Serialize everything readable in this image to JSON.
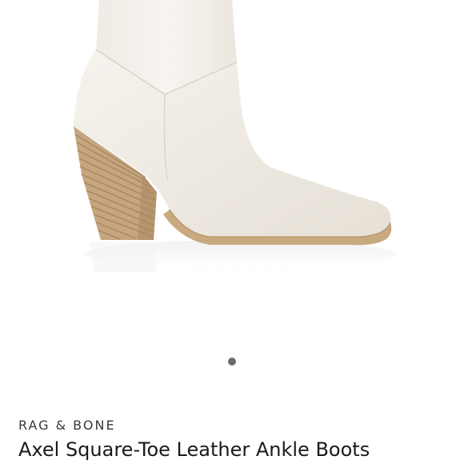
{
  "product": {
    "brand": "RAG & BONE",
    "name": "Axel Square-Toe Leather Ankle Boots",
    "image_icon": "ankle-boot-image"
  },
  "carousel": {
    "total_images": 1,
    "active_index": 1
  },
  "colors": {
    "leather": "#efebe4",
    "heel": "#c4a47c",
    "dot": "#6b6b6b"
  }
}
